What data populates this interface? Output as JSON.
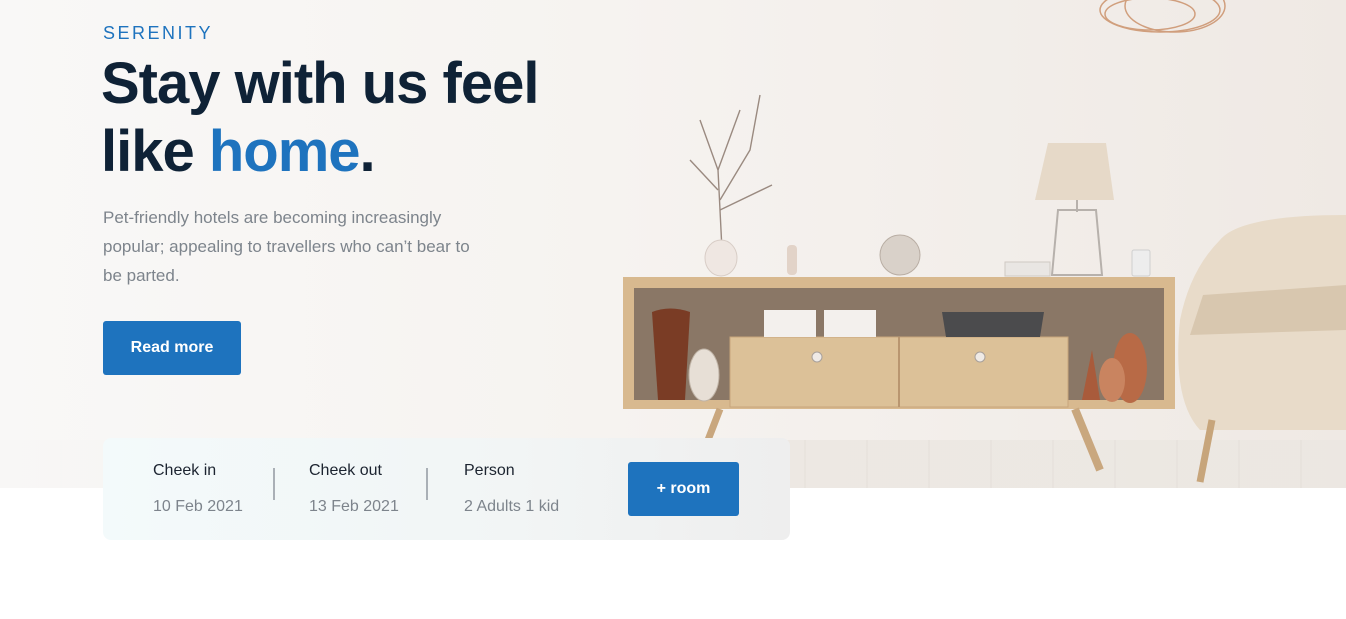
{
  "hero": {
    "brand": "SERENITY",
    "headline_line1": "Stay with us feel",
    "headline_like": "like ",
    "headline_accent": "home",
    "headline_period": ".",
    "subtext": "Pet-friendly hotels are becoming increasingly popular; appealing to travellers who can’t bear to be parted.",
    "read_more_label": "Read more"
  },
  "booking": {
    "check_in_label": "Cheek in",
    "check_in_value": "10 Feb 2021",
    "check_out_label": "Cheek out",
    "check_out_value": "13 Feb 2021",
    "person_label": "Person",
    "person_value": "2 Adults 1 kid",
    "room_button_label": "+ room"
  },
  "colors": {
    "accent": "#1e73be",
    "heading": "#0f2236",
    "muted": "#7d848c"
  }
}
